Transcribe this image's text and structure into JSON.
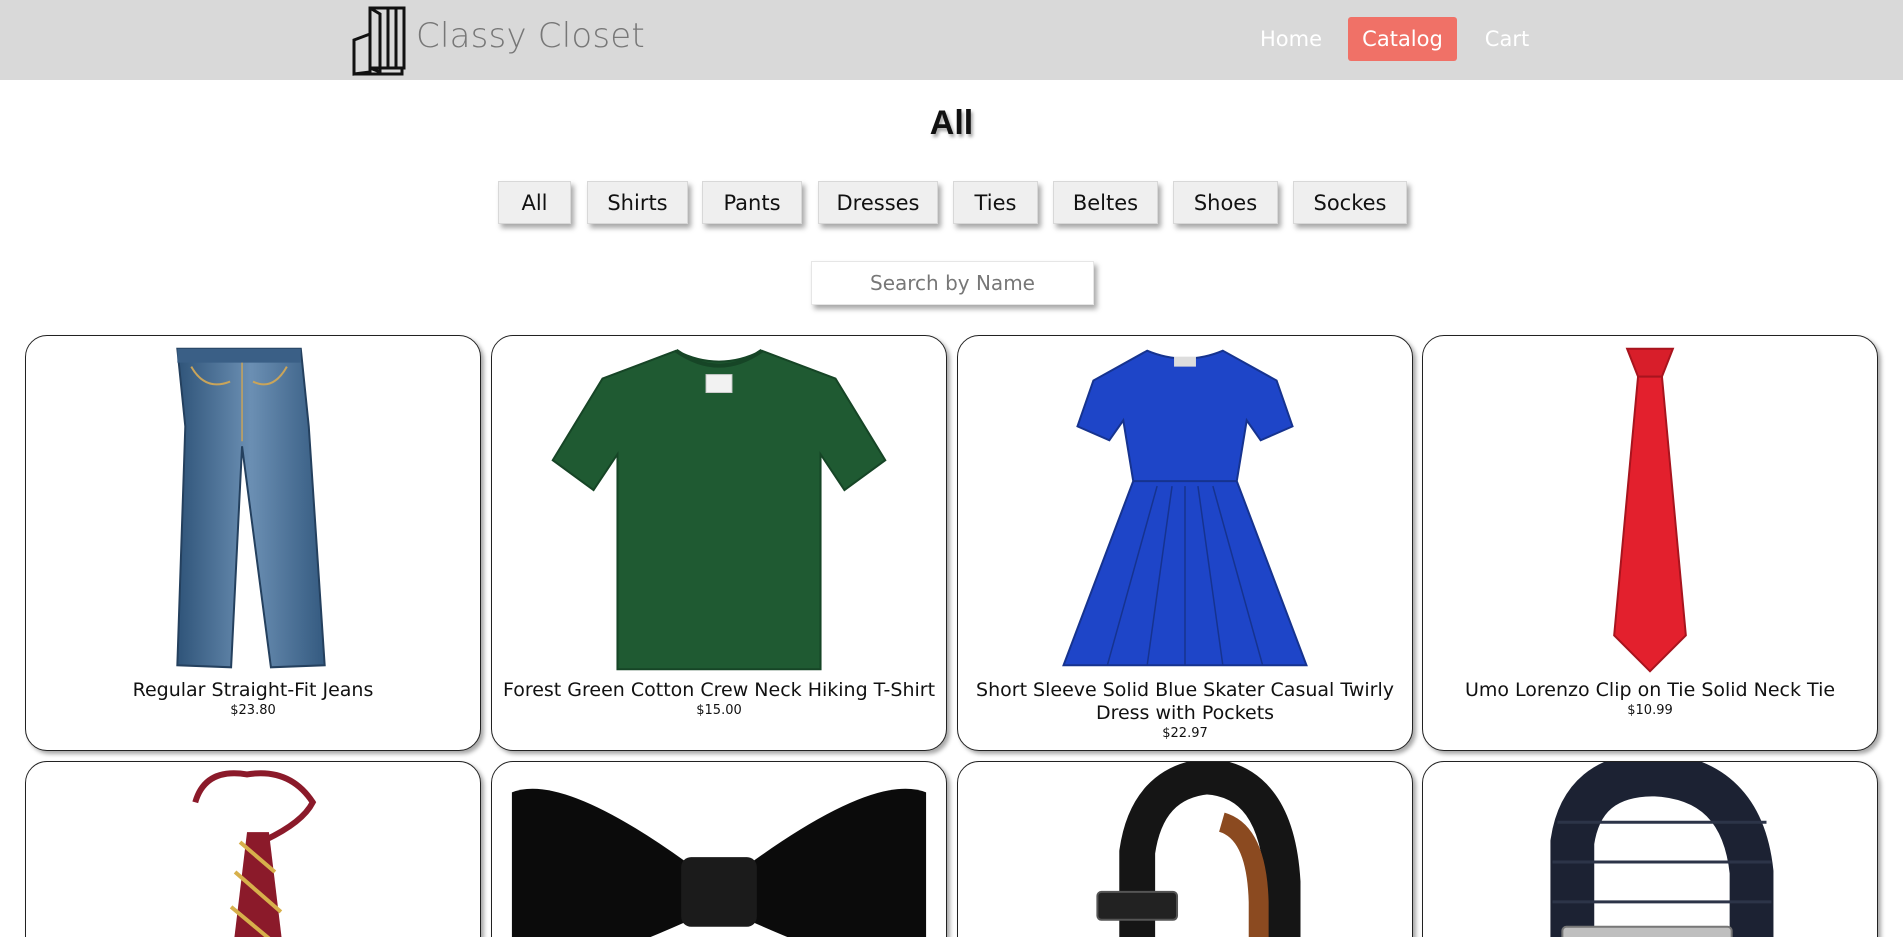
{
  "header": {
    "brand": "Classy Closet",
    "nav": {
      "home": "Home",
      "catalog": "Catalog",
      "cart": "Cart"
    },
    "accent_color": "#f07167",
    "background_color": "#d9d9d9"
  },
  "page_title": "All",
  "categories": [
    "All",
    "Shirts",
    "Pants",
    "Dresses",
    "Ties",
    "Beltes",
    "Shoes",
    "Sockes"
  ],
  "search": {
    "placeholder": "Search by Name",
    "value": ""
  },
  "products": [
    {
      "name": "Regular Straight-Fit Jeans",
      "price": "$23.80",
      "icon": "jeans"
    },
    {
      "name": "Forest Green Cotton Crew Neck Hiking T-Shirt",
      "price": "$15.00",
      "icon": "t-shirt"
    },
    {
      "name": "Short Sleeve Solid Blue Skater Casual Twirly Dress with Pockets",
      "price": "$22.97",
      "icon": "dress"
    },
    {
      "name": "Umo Lorenzo Clip on Tie Solid Neck Tie",
      "price": "$10.99",
      "icon": "neck-tie"
    },
    {
      "name": "",
      "price": "",
      "icon": "striped-tie"
    },
    {
      "name": "",
      "price": "",
      "icon": "bow-tie"
    },
    {
      "name": "",
      "price": "",
      "icon": "leather-belt"
    },
    {
      "name": "",
      "price": "",
      "icon": "canvas-belt"
    }
  ]
}
